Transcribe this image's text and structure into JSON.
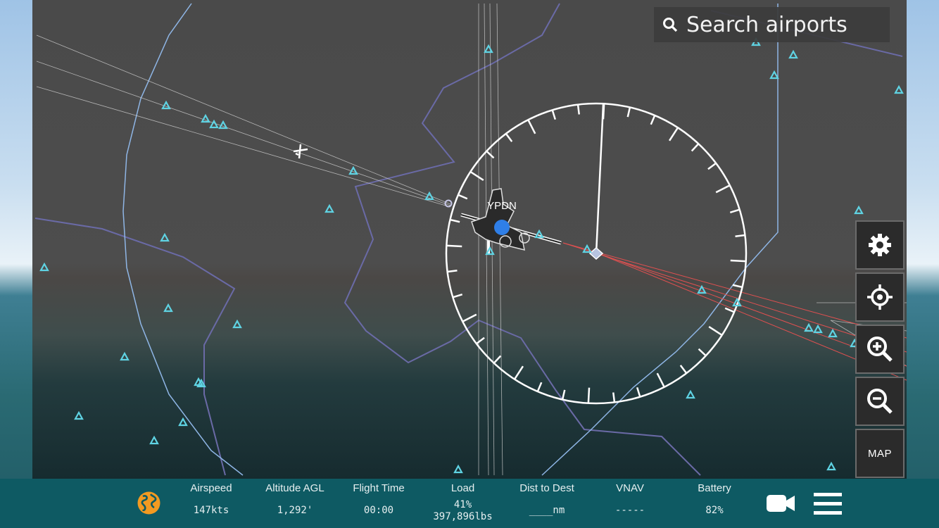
{
  "search": {
    "placeholder": "Search airports"
  },
  "map": {
    "airport_label": "YPDN",
    "side_buttons": [
      "settings-gear",
      "center-crosshair",
      "zoom-in",
      "zoom-out",
      "map"
    ],
    "map_button_label": "MAP"
  },
  "bottom": {
    "stats": [
      {
        "label": "Airspeed",
        "value": "147kts"
      },
      {
        "label": "Altitude AGL",
        "value": "1,292'"
      },
      {
        "label": "Flight Time",
        "value": "00:00"
      },
      {
        "label": "Load",
        "value": "41%",
        "value2": "397,896lbs"
      },
      {
        "label": "Dist to Dest",
        "value": "____nm"
      },
      {
        "label": "VNAV",
        "value": "-----"
      },
      {
        "label": "Battery",
        "value": "82%"
      }
    ],
    "icons": [
      "globe-icon",
      "camera-icon",
      "menu-icon"
    ]
  },
  "colors": {
    "bottom_bar": "#0e5a63",
    "airport_triangle": "#5fd3e3",
    "route_red": "#e05050",
    "aircraft_blue": "#2f7fe8",
    "globe_orange": "#f29a21"
  }
}
